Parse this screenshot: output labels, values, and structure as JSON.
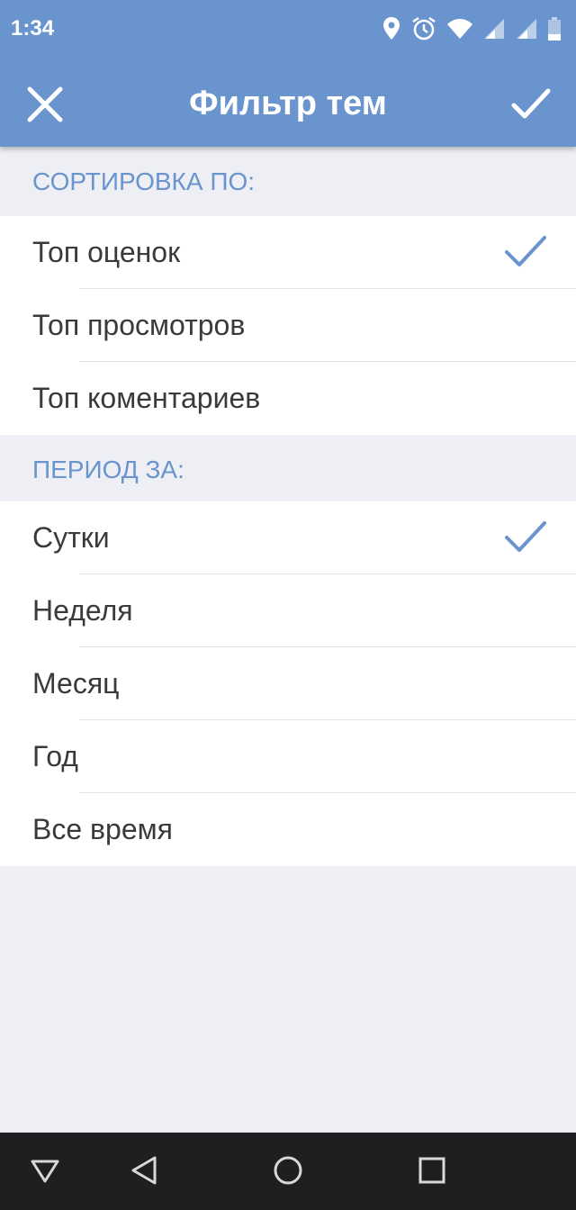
{
  "status": {
    "time": "1:34"
  },
  "header": {
    "title": "Фильтр тем"
  },
  "sort": {
    "title": "СОРТИРОВКА ПО:",
    "items": [
      {
        "label": "Топ оценок",
        "selected": true
      },
      {
        "label": "Топ просмотров",
        "selected": false
      },
      {
        "label": "Топ коментариев",
        "selected": false
      }
    ]
  },
  "period": {
    "title": "ПЕРИОД ЗА:",
    "items": [
      {
        "label": "Сутки",
        "selected": true
      },
      {
        "label": "Неделя",
        "selected": false
      },
      {
        "label": "Месяц",
        "selected": false
      },
      {
        "label": "Год",
        "selected": false
      },
      {
        "label": "Все время",
        "selected": false
      }
    ]
  },
  "colors": {
    "accent": "#6a94cd",
    "background": "#eeeff5",
    "navbar": "#1f1f21"
  },
  "icons": [
    "location-icon",
    "alarm-icon",
    "wifi-icon",
    "signal-icon",
    "battery-icon",
    "close-icon",
    "check-icon",
    "nav-triangle-icon",
    "back-icon",
    "home-icon",
    "recents-icon"
  ]
}
